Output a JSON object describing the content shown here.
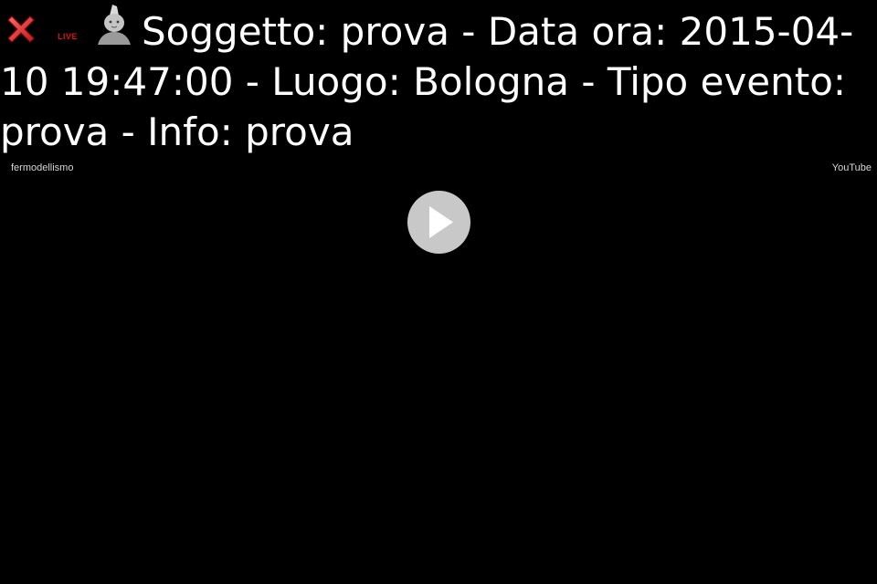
{
  "header": {
    "live_label": "LIVE",
    "title": "Soggetto: prova - Data ora: 2015-04-10 19:47:00 - Luogo: Bologna - Tipo evento: prova - Info: prova"
  },
  "video": {
    "channel_name": "fermodellismo",
    "provider_label": "YouTube"
  },
  "icons": {
    "close": "close-icon",
    "avatar": "avatar-icon",
    "play": "play-icon"
  },
  "colors": {
    "background": "#000000",
    "title_text": "#ffffff",
    "close_icon": "#e03030",
    "live_badge": "#e01010",
    "play_button": "#c8c8c8",
    "play_triangle": "#ffffff"
  }
}
